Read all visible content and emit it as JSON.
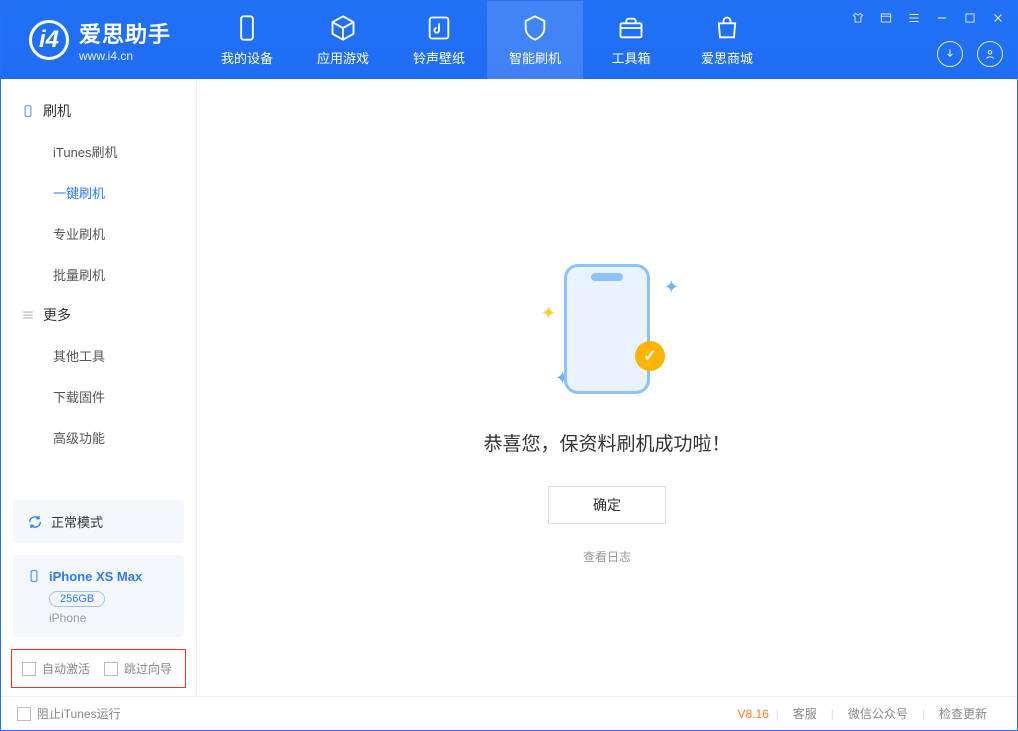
{
  "logo": {
    "name": "爱思助手",
    "url": "www.i4.cn"
  },
  "tabs": [
    {
      "label": "我的设备"
    },
    {
      "label": "应用游戏"
    },
    {
      "label": "铃声壁纸"
    },
    {
      "label": "智能刷机"
    },
    {
      "label": "工具箱"
    },
    {
      "label": "爱思商城"
    }
  ],
  "sidebar": {
    "section1": {
      "title": "刷机"
    },
    "items1": [
      {
        "label": "iTunes刷机"
      },
      {
        "label": "一键刷机"
      },
      {
        "label": "专业刷机"
      },
      {
        "label": "批量刷机"
      }
    ],
    "section2": {
      "title": "更多"
    },
    "items2": [
      {
        "label": "其他工具"
      },
      {
        "label": "下载固件"
      },
      {
        "label": "高级功能"
      }
    ]
  },
  "mode": {
    "label": "正常模式"
  },
  "device": {
    "name": "iPhone XS Max",
    "capacity": "256GB",
    "type": "iPhone"
  },
  "bottom_options": {
    "auto_activate": "自动激活",
    "skip_guide": "跳过向导"
  },
  "main": {
    "success_text": "恭喜您，保资料刷机成功啦！",
    "ok_button": "确定",
    "log_link": "查看日志"
  },
  "footer": {
    "block_itunes": "阻止iTunes运行",
    "version": "V8.16",
    "support": "客服",
    "wechat": "微信公众号",
    "check_update": "检查更新"
  }
}
